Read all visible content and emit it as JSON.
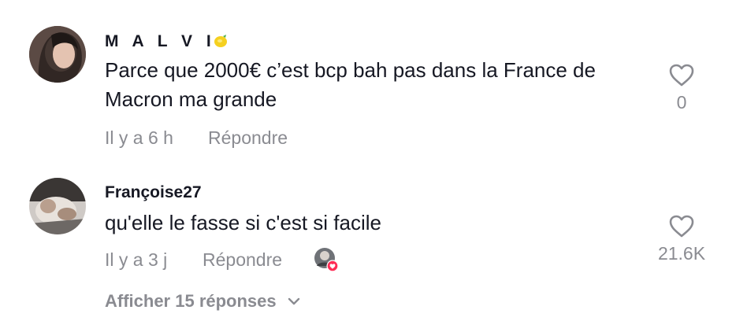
{
  "comments": [
    {
      "username": "M A L V I",
      "username_emoji": "lemon-emoji",
      "text": "Parce que 2000€ c’est bcp bah pas dans la France de Macron ma grande",
      "timestamp": "Il y a 6 h",
      "reply_label": "Répondre",
      "like_count": "0",
      "like_icon": "heart-outline-icon"
    },
    {
      "username": "Françoise27",
      "text": "qu'elle le fasse si c'est si facile",
      "timestamp": "Il y a 3 j",
      "reply_label": "Répondre",
      "creator_liked": true,
      "like_count": "21.6K",
      "like_icon": "heart-outline-icon",
      "view_replies_label": "Afficher 15 réponses"
    }
  ],
  "colors": {
    "text": "#161823",
    "muted": "#8a8b91",
    "heart_badge": "#fe2c55"
  }
}
